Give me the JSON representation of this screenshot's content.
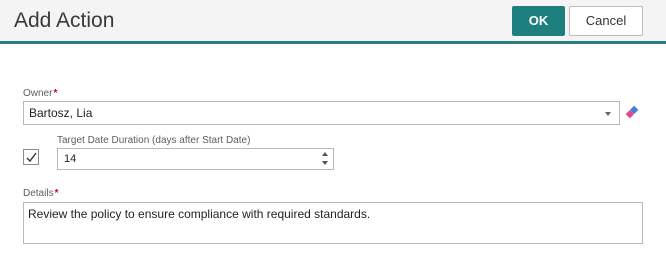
{
  "dialog": {
    "title": "Add Action",
    "ok_label": "OK",
    "cancel_label": "Cancel"
  },
  "owner": {
    "label": "Owner",
    "required_mark": "*",
    "value": "Bartosz, Lia"
  },
  "target_date": {
    "checked": true,
    "label": "Target Date Duration (days after Start Date)",
    "value": "14"
  },
  "details": {
    "label": "Details",
    "required_mark": "*",
    "value": "Review the policy to ensure compliance with required standards."
  },
  "colors": {
    "accent": "#1e7f7f",
    "required": "#d0021b"
  }
}
